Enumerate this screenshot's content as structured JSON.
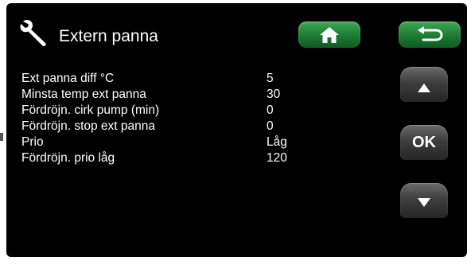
{
  "header": {
    "title": "Extern panna",
    "icon": "wrench-icon"
  },
  "nav": {
    "home_icon": "home-icon",
    "back_icon": "back-arrow-icon",
    "up_icon": "arrow-up-icon",
    "ok_label": "OK",
    "down_icon": "arrow-down-icon"
  },
  "settings": {
    "rows": [
      {
        "label": "Ext panna diff °C",
        "value": "5"
      },
      {
        "label": "Minsta temp ext panna",
        "value": "30"
      },
      {
        "label": "Fördröjn. cirk pump (min)",
        "value": "0"
      },
      {
        "label": "Fördröjn. stop ext panna",
        "value": "0"
      },
      {
        "label": "Prio",
        "value": "Låg"
      },
      {
        "label": "Fördröjn. prio låg",
        "value": "120"
      }
    ]
  },
  "colors": {
    "background": "#000000",
    "text": "#ffffff",
    "accent_green": "#1d7a33",
    "side_button": "#3e3e3e"
  }
}
